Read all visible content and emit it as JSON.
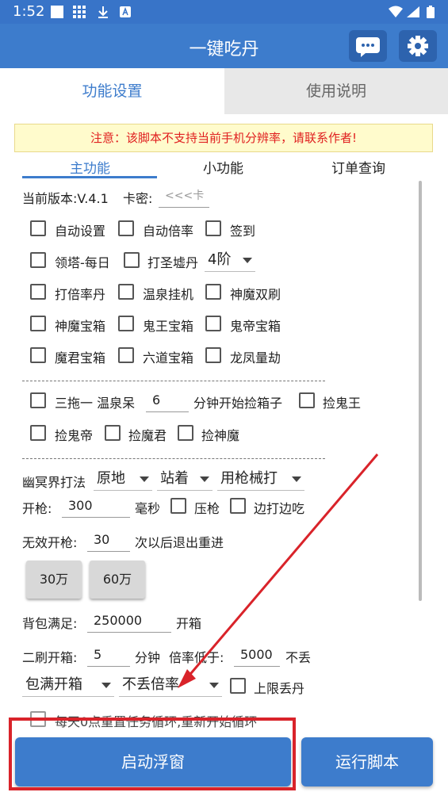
{
  "status": {
    "time": "1:52"
  },
  "app": {
    "title": "一键吃丹",
    "chat_icon": "chat-bubble-icon",
    "settings_icon": "gear-icon"
  },
  "tabs": {
    "settings": "功能设置",
    "instructions": "使用说明"
  },
  "notice": "注意：该脚本不支持当前手机分辨率，请联系作者!",
  "subtabs": {
    "main": "主功能",
    "small": "小功能",
    "orders": "订单查询"
  },
  "version": {
    "label": "当前版本:V.4.1",
    "key_label": "卡密:",
    "key_value": "<<<卡"
  },
  "checks": {
    "auto_settings": "自动设置",
    "auto_rate": "自动倍率",
    "sign_in": "签到",
    "tower_daily": "领塔-每日",
    "saint_furnace": "打圣墟丹",
    "stage_value": "4阶",
    "rate_pill": "打倍率丹",
    "hot_spring": "温泉挂机",
    "demon_double": "神魔双刷",
    "demon_box": "神魔宝箱",
    "ghost_king_box": "鬼王宝箱",
    "ghost_emperor_box": "鬼帝宝箱",
    "demon_lord_box": "魔君宝箱",
    "six_paths_box": "六道宝箱",
    "dragon_phoenix": "龙凤量劫"
  },
  "tow": {
    "label": "三拖一 温泉呆",
    "minutes": "6",
    "after": "分钟开始捡箱子",
    "ghost_king": "捡鬼王",
    "ghost_emperor": "捡鬼帝",
    "demon_lord": "捡魔君",
    "god_demon": "捡神魔"
  },
  "netherworld": {
    "label": "幽冥界打法",
    "opt1": "原地",
    "opt2": "站着",
    "opt3": "用枪械打",
    "fire_label": "开枪:",
    "fire_ms": "300",
    "ms_unit": "毫秒",
    "press": "压枪",
    "fire_eat": "边打边吃",
    "invalid_label": "无效开枪:",
    "invalid_value": "30",
    "invalid_after": "次以后退出重进"
  },
  "buttons": {
    "b30": "30万",
    "b60": "60万"
  },
  "bag": {
    "label": "背包满足:",
    "value": "250000",
    "after": "开箱"
  },
  "second": {
    "label": "二刷开箱:",
    "minutes": "5",
    "min_unit": "分钟",
    "rate_label": "倍率低于:",
    "rate_value": "5000",
    "no_drop": "不丢"
  },
  "drop": {
    "opt1": "包满开箱",
    "opt2": "不丢倍率",
    "limit": "上限丢丹"
  },
  "reset": "每天0点重置任务循环,重新开始循环",
  "footer": {
    "float": "启动浮窗",
    "run": "运行脚本"
  },
  "colors": {
    "primary": "#3d7ccc",
    "annotation": "#d9232a",
    "notice_text": "#e02020"
  }
}
